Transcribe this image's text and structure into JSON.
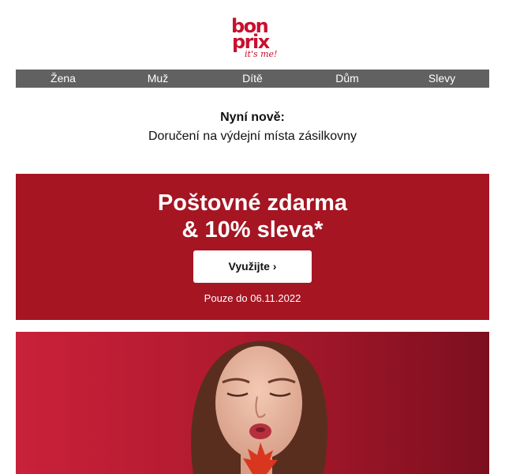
{
  "brand": {
    "logo_line1": "bon",
    "logo_line2": "prix",
    "logo_tagline": "it's me!",
    "color": "#c8102e"
  },
  "nav": {
    "items": [
      {
        "label": "Žena"
      },
      {
        "label": "Muž"
      },
      {
        "label": "Dítě"
      },
      {
        "label": "Dům"
      },
      {
        "label": "Slevy"
      }
    ]
  },
  "notice": {
    "title": "Nyní nově:",
    "text": "Doručení na výdejní místa zásilkovny"
  },
  "promo": {
    "headline_line1": "Poštovné zdarma",
    "headline_line2": "& 10% sleva*",
    "cta_label": "Využijte ›",
    "valid_until": "Pouze do 06.11.2022",
    "background": "#a51522"
  },
  "hero": {
    "description_icon": "woman-portrait-image"
  }
}
